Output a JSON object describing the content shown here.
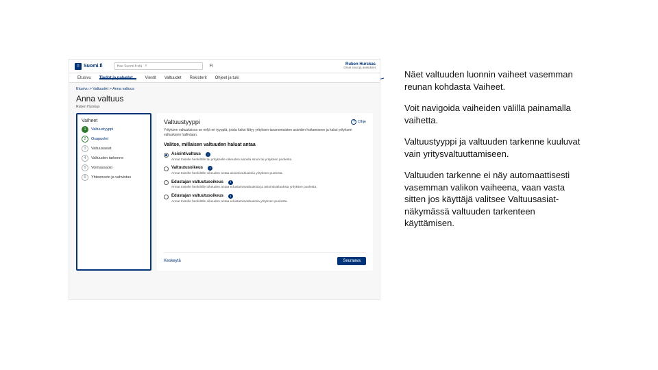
{
  "notes": {
    "p1": "Näet valtuuden luonnin vaiheet vasemman reunan kohdasta Vaiheet.",
    "p2": "Voit navigoida vaiheiden välillä painamalla vaihetta.",
    "p3": "Valtuustyyppi ja valtuuden tarkenne kuuluvat vain yritysvaltuuttamiseen.",
    "p4": "Valtuuden tarkenne ei näy automaattisesti vasemman valikon vaiheena, vaan vasta sitten jos käyttäjä valitsee Valtuusasiat-näkymässä valtuuden tarkenteen käyttämisen."
  },
  "app": {
    "brand": "Suomi.fi",
    "search_placeholder": "Hae Suomi.fi:stä",
    "lang": "FI",
    "account": {
      "name": "Ruben Hurskas",
      "sub": "Omat sivut ja asetukset"
    },
    "nav": {
      "home": "Etusivu",
      "info": "Tiedot ja palvelut",
      "msgs": "Viestit",
      "auth": "Valtuudet",
      "reg": "Rekisterit",
      "guide": "Ohjeet ja tuki"
    },
    "crumbs": "Etusivu > Valtuudet > Anna valtuus",
    "title": "Anna valtuus",
    "sub": "Ruben Hurskas",
    "steps_title": "Vaiheet",
    "steps": [
      {
        "n": "1",
        "label": "Valtuustyyppi"
      },
      {
        "n": "2",
        "label": "Osapuolet"
      },
      {
        "n": "3",
        "label": "Valtuusasiat"
      },
      {
        "n": "4",
        "label": "Valtuuden tarkenne"
      },
      {
        "n": "5",
        "label": "Voimassaolo"
      },
      {
        "n": "6",
        "label": "Yhteenveto ja vahvistus"
      }
    ],
    "card": {
      "title": "Valtuustyyppi",
      "help": "Ohje",
      "lead": "Yrityksen valtuuksissa on neljä eri tyyppiä, joista kaksi liittyy yrityksen tavanomaisten asioiden hoitamiseen ja kaksi yrityksen valtuuksien hallintaan.",
      "choice_title": "Valitse, millaisen valtuuden haluat antaa",
      "opts": [
        {
          "label": "Asiointivaltuus",
          "desc": "Annat toiselle henkilölle tai yritykselle oikeuden asioida sinun tai yrityksen puolesta."
        },
        {
          "label": "Valtuutusoikeus",
          "desc": "Annat toiselle henkilölle oikeuden antaa asiointivaltuuksia yrityksen puolesta."
        },
        {
          "label": "Edustajan valtuutusoikeus",
          "desc": "Annat toiselle henkilölle oikeuden antaa edustamisvaltuuksia ja asiointivaltuuksia yrityksen puolesta."
        },
        {
          "label": "Edustajan valtuutusoikeus",
          "desc": "Annat toiselle henkilölle oikeuden antaa edustamisvaltuuksia yrityksen puolesta."
        }
      ],
      "cancel": "Keskeytä",
      "next": "Seuraava"
    }
  }
}
